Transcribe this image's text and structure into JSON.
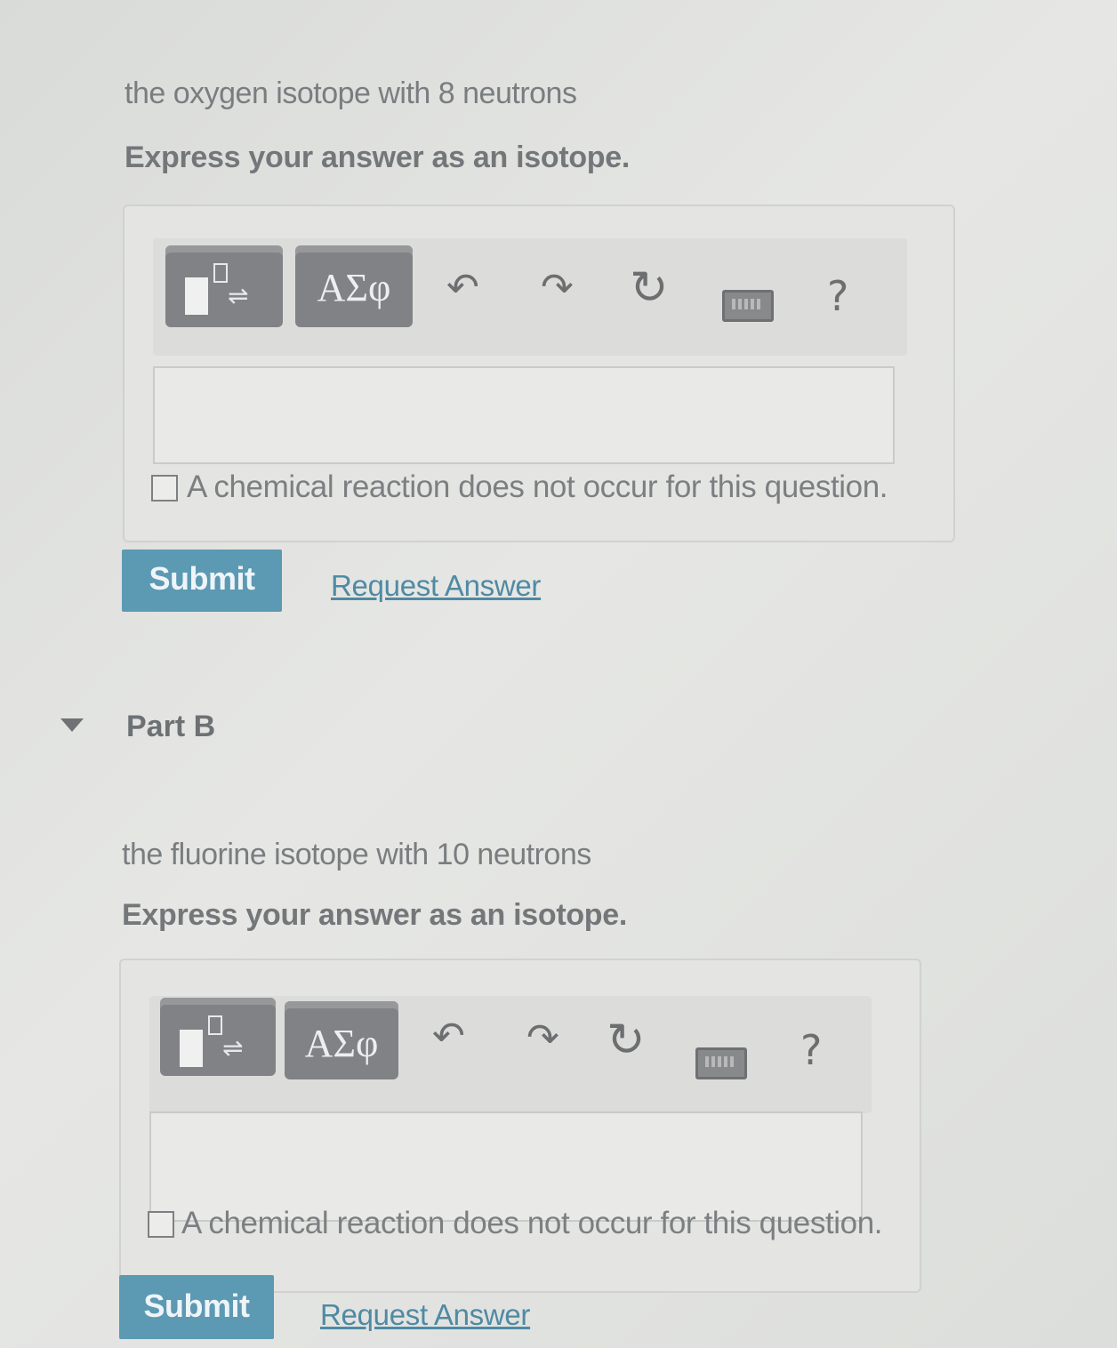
{
  "part_a": {
    "question": "the oxygen isotope with 8 neutrons",
    "instruction": "Express your answer as an isotope.",
    "toolbar": {
      "template_icon": "templates-icon",
      "greek_label": "ΑΣφ",
      "undo_icon": "undo-icon",
      "redo_icon": "redo-icon",
      "reset_icon": "reset-icon",
      "keyboard_icon": "keyboard-icon",
      "help_label": "?"
    },
    "answer_value": "",
    "no_reaction_label": "A chemical reaction does not occur for this question.",
    "submit_label": "Submit",
    "request_label": "Request Answer"
  },
  "part_b": {
    "title": "Part B",
    "question": "the fluorine isotope with 10 neutrons",
    "instruction": "Express your answer as an isotope.",
    "toolbar": {
      "template_icon": "templates-icon",
      "greek_label": "ΑΣφ",
      "undo_icon": "undo-icon",
      "redo_icon": "redo-icon",
      "reset_icon": "reset-icon",
      "keyboard_icon": "keyboard-icon",
      "help_label": "?"
    },
    "answer_value": "",
    "no_reaction_label": "A chemical reaction does not occur for this question.",
    "submit_label": "Submit",
    "request_label": "Request Answer"
  }
}
